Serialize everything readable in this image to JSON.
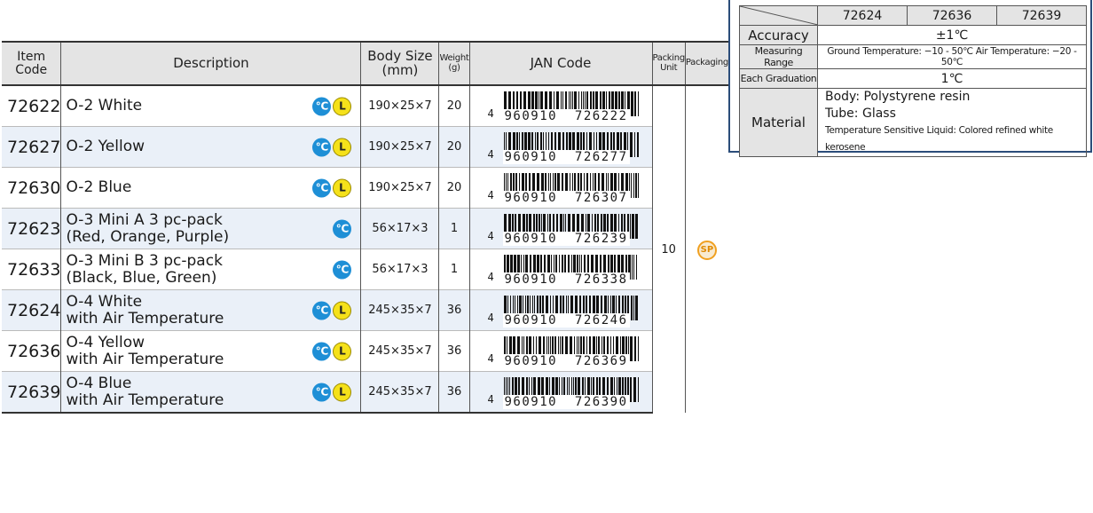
{
  "product_table": {
    "headers": {
      "item_code": "Item\nCode",
      "description": "Description",
      "body_size": "Body Size\n(mm)",
      "weight": "Weight\n(g)",
      "jan_code": "JAN Code",
      "packing_unit": "Packing\nUnit",
      "packaging": "Packaging"
    },
    "rows": [
      {
        "code": "72622",
        "desc1": "O-2 White",
        "desc2": "",
        "icon_c": true,
        "icon_l": true,
        "size": "190×25×7",
        "weight": "20",
        "jan_lead": "4",
        "jan_digits": "960910  726222"
      },
      {
        "code": "72627",
        "desc1": "O-2 Yellow",
        "desc2": "",
        "icon_c": true,
        "icon_l": true,
        "size": "190×25×7",
        "weight": "20",
        "jan_lead": "4",
        "jan_digits": "960910  726277"
      },
      {
        "code": "72630",
        "desc1": "O-2 Blue",
        "desc2": "",
        "icon_c": true,
        "icon_l": true,
        "size": "190×25×7",
        "weight": "20",
        "jan_lead": "4",
        "jan_digits": "960910  726307"
      },
      {
        "code": "72623",
        "desc1": "O-3 Mini A 3 pc-pack",
        "desc2": "(Red, Orange, Purple)",
        "icon_c": true,
        "icon_l": false,
        "size": "56×17×3",
        "weight": "1",
        "jan_lead": "4",
        "jan_digits": "960910  726239"
      },
      {
        "code": "72633",
        "desc1": "O-3 Mini B 3 pc-pack",
        "desc2": "(Black, Blue, Green)",
        "icon_c": true,
        "icon_l": false,
        "size": "56×17×3",
        "weight": "1",
        "jan_lead": "4",
        "jan_digits": "960910  726338"
      },
      {
        "code": "72624",
        "desc1": "O-4 White",
        "desc2": "with Air Temperature",
        "icon_c": true,
        "icon_l": true,
        "size": "245×35×7",
        "weight": "36",
        "jan_lead": "4",
        "jan_digits": "960910  726246"
      },
      {
        "code": "72636",
        "desc1": "O-4 Yellow",
        "desc2": "with Air Temperature",
        "icon_c": true,
        "icon_l": true,
        "size": "245×35×7",
        "weight": "36",
        "jan_lead": "4",
        "jan_digits": "960910  726369"
      },
      {
        "code": "72639",
        "desc1": "O-4 Blue",
        "desc2": "with Air Temperature",
        "icon_c": true,
        "icon_l": true,
        "size": "245×35×7",
        "weight": "36",
        "jan_lead": "4",
        "jan_digits": "960910  726390"
      }
    ],
    "packing_unit_value": "10",
    "packaging_icon": "SP",
    "icon_c_glyph": "℃",
    "icon_l_glyph": "L",
    "colors": {
      "icon_c": "#1e8fd6",
      "icon_l": "#f5e11a",
      "packaging": "#f0a020",
      "row_shade": "#eaf0f8",
      "header_bg": "#e4e4e4"
    }
  },
  "spec_table": {
    "columns": [
      "72624",
      "72636",
      "72639"
    ],
    "accuracy_label": "Accuracy",
    "accuracy_value": "±1℃",
    "range_label": "Measuring Range",
    "range_value": "Ground Temperature: −10 - 50℃   Air Temperature: −20 - 50℃",
    "graduation_label": "Each Graduation",
    "graduation_value": "1℃",
    "material_label": "Material",
    "material_body": "Body: Polystyrene resin",
    "material_tube": "Tube: Glass",
    "material_liquid": "Temperature Sensitive Liquid: Colored refined white kerosene"
  }
}
